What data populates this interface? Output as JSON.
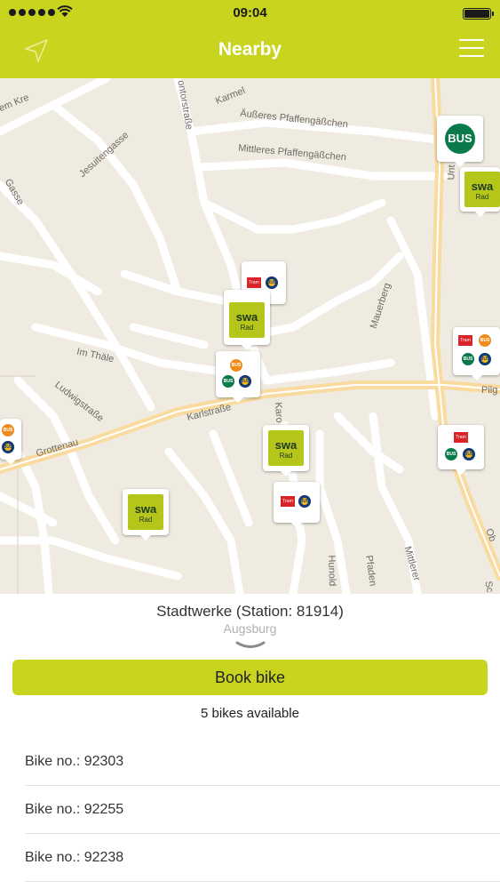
{
  "status_bar": {
    "time": "09:04"
  },
  "nav": {
    "title": "Nearby"
  },
  "map": {
    "streets": [
      "Äußeres Pfaffengäßchen",
      "Mittleres Pfaffengäßchen",
      "Jesuitengasse",
      "Im Thäle",
      "Ludwigstraße",
      "Karlstraße",
      "Grottenau",
      "Mauerberg",
      "Pilg",
      "Gasse",
      "em Kre",
      "Karmel",
      "ontorstraße",
      "Unt",
      "Karo",
      "Mittlerer",
      "Pfaden",
      "Hunold",
      "Sc",
      "Ob"
    ],
    "markers": {
      "bus_label": "BUS",
      "swa_label": "swa",
      "rad_label": "Rad",
      "tram_label": "Tram"
    }
  },
  "station": {
    "name": "Stadtwerke (Station: 81914)",
    "city": "Augsburg",
    "book_label": "Book bike",
    "availability": "5 bikes available",
    "bikes": [
      "Bike no.: 92303",
      "Bike no.: 92255",
      "Bike no.: 92238"
    ]
  },
  "colors": {
    "accent": "#c8d41e",
    "bus_green": "#0a7a4c",
    "tram_red": "#d9252a"
  }
}
